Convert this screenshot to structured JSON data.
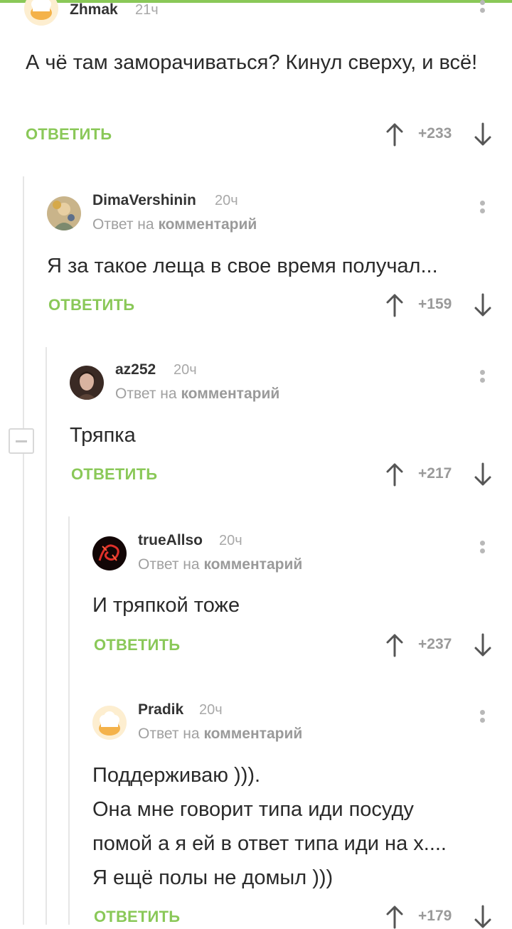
{
  "reply_label": "ОТВЕТИТЬ",
  "reply_to_prefix": "Ответ на",
  "reply_to_link": "комментарий",
  "colors": {
    "accent": "#8ac858",
    "muted": "#a0a0a0"
  },
  "comments": [
    {
      "author": "Zhmak",
      "time": "21ч",
      "text": "А чё там заморачиваться? Кинул сверху, и всё!",
      "score": "+233",
      "avatar_icon": "chef-hat-avatar-icon"
    },
    {
      "author": "DimaVershinin",
      "time": "20ч",
      "text": "Я за такое леща в свое время получал...",
      "score": "+159",
      "avatar_icon": "photo-avatar-icon"
    },
    {
      "author": "az252",
      "time": "20ч",
      "text": "Тряпка",
      "score": "+217",
      "avatar_icon": "photo-avatar-icon"
    },
    {
      "author": "trueAllso",
      "time": "20ч",
      "text": "И тряпкой тоже",
      "score": "+237",
      "avatar_icon": "dragon-avatar-icon"
    },
    {
      "author": "Pradik",
      "time": "20ч",
      "text_lines": [
        "Поддерживаю ))).",
        "Она мне говорит типа иди посуду",
        "помой а я ей в ответ типа иди на х....",
        "Я ещё полы не домыл )))"
      ],
      "score": "+179",
      "avatar_icon": "chef-hat-avatar-icon"
    }
  ]
}
